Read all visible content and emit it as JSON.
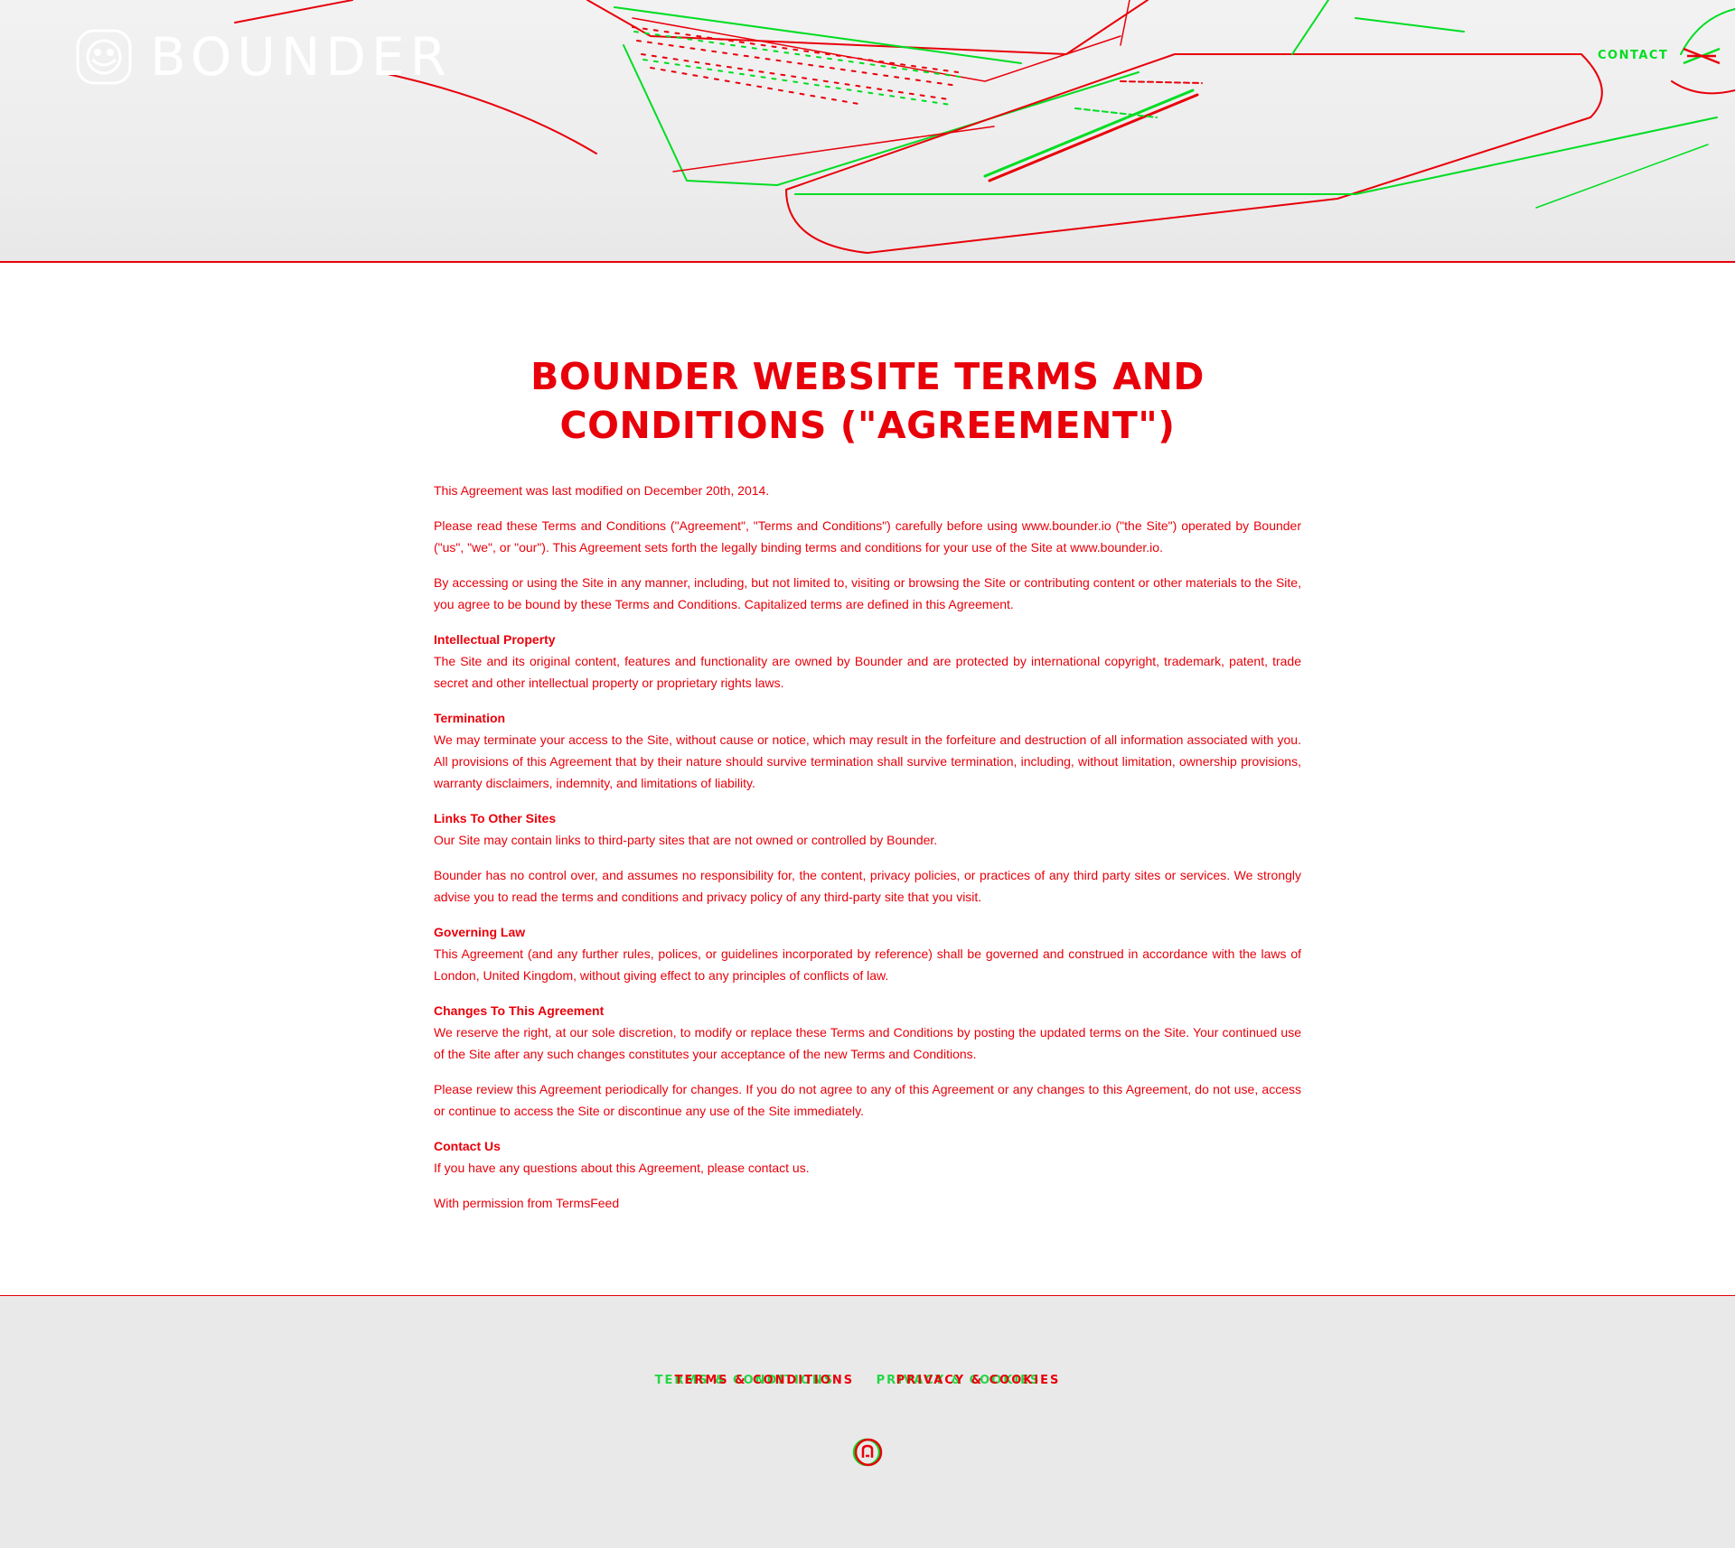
{
  "header": {
    "logo_text": "BOUNDER",
    "nav": {
      "contact_label": "CONTACT"
    }
  },
  "main": {
    "title": "BOUNDER WEBSITE TERMS AND CONDITIONS (\"AGREEMENT\")",
    "intro": [
      "This Agreement was last modified on December 20th, 2014.",
      "Please read these Terms and Conditions (\"Agreement\", \"Terms and Conditions\") carefully before using www.bounder.io (\"the Site\") operated by Bounder (\"us\", \"we\", or \"our\"). This Agreement sets forth the legally binding terms and conditions for your use of the Site at www.bounder.io.",
      "By accessing or using the Site in any manner, including, but not limited to, visiting or browsing the Site or contributing content or other materials to the Site, you agree to be bound by these Terms and Conditions. Capitalized terms are defined in this Agreement."
    ],
    "sections": {
      "ip": {
        "heading": "Intellectual Property",
        "body": "The Site and its original content, features and functionality are owned by Bounder and are protected by international copyright, trademark, patent, trade secret and other intellectual property or proprietary rights laws."
      },
      "termination": {
        "heading": "Termination",
        "body": "We may terminate your access to the Site, without cause or notice, which may result in the forfeiture and destruction of all information associated with you. All provisions of this Agreement that by their nature should survive termination shall survive termination, including, without limitation, ownership provisions, warranty disclaimers, indemnity, and limitations of liability."
      },
      "links": {
        "heading": "Links To Other Sites",
        "body": "Our Site may contain links to third-party sites that are not owned or controlled by Bounder.",
        "body2": "Bounder has no control over, and assumes no responsibility for, the content, privacy policies, or practices of any third party sites or services. We strongly advise you to read the terms and conditions and privacy policy of any third-party site that you visit."
      },
      "law": {
        "heading": "Governing Law",
        "body": "This Agreement (and any further rules, polices, or guidelines incorporated by reference) shall be governed and construed in accordance with the laws of London, United Kingdom, without giving effect to any principles of conflicts of law."
      },
      "changes": {
        "heading": "Changes To This Agreement",
        "body": "We reserve the right, at our sole discretion, to modify or replace these Terms and Conditions by posting the updated terms on the Site. Your continued use of the Site after any such changes constitutes your acceptance of the new Terms and Conditions.",
        "body2": "Please review this Agreement periodically for changes. If you do not agree to any of this Agreement or any changes to this Agreement, do not use, access or continue to access the Site or discontinue any use of the Site immediately."
      },
      "contact": {
        "heading": "Contact Us",
        "body": "If you have any questions about this Agreement, please contact us."
      }
    },
    "attribution": {
      "prefix": "With permission from ",
      "link_label": "TermsFeed"
    }
  },
  "footer": {
    "links": [
      {
        "label": "TERMS & CONDITIONS"
      },
      {
        "label": "PRIVACY & COOKIES"
      }
    ],
    "icon": "social-circle-icon"
  },
  "colors": {
    "text_accent": "#e8000a",
    "nav_accent": "#00dd22",
    "footer_bg": "#e9e9e9",
    "hero_bg": "#f0f0f0"
  }
}
